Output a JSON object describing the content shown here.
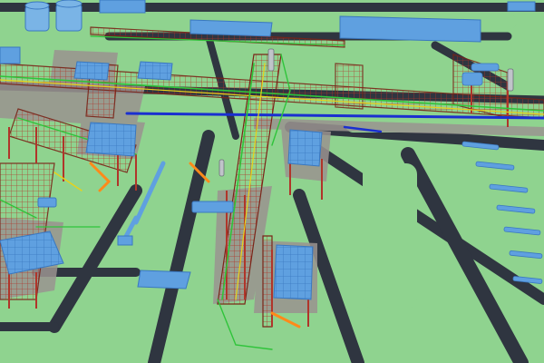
{
  "scene": {
    "palette": {
      "ground": "#8fd38f",
      "road": "#2f3540",
      "road_edge": "#6a7078",
      "platform": "#9a9390",
      "steel": "#b0352a",
      "steel_dark": "#7a2418",
      "pipe_green": "#2fc43a",
      "pipe_yellow": "#e8d21a",
      "pipe_blue": "#1a2fd0",
      "pipe_orange": "#ff8a1a",
      "equipment": "#5fa0e0",
      "equipment_dark": "#3a78c0",
      "tank": "#7ab4e6"
    }
  }
}
